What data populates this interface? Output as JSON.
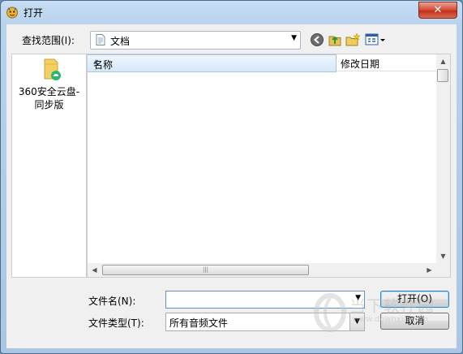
{
  "window": {
    "title": "打开",
    "close_label": "✕"
  },
  "lookin": {
    "label": "查找范围(I):",
    "value": "文档"
  },
  "toolbar": {
    "back": "back-icon",
    "up": "up-folder-icon",
    "new_folder": "new-folder-icon",
    "views": "views-menu-icon"
  },
  "places": [
    {
      "label": "360安全云盘-同步版",
      "icon": "cloud-folder-icon"
    }
  ],
  "list": {
    "columns": [
      "名称",
      "修改日期"
    ]
  },
  "filename": {
    "label": "文件名(N):",
    "value": ""
  },
  "filetype": {
    "label": "文件类型(T):",
    "value": "所有音频文件"
  },
  "buttons": {
    "open": "打开(O)",
    "cancel": "取消"
  },
  "watermark": {
    "brand": "当下软件园",
    "url": "www.downxia.com"
  },
  "colors": {
    "accent": "#3c7fb1",
    "window_frame": "#aac6e3",
    "close": "#c1301a"
  }
}
